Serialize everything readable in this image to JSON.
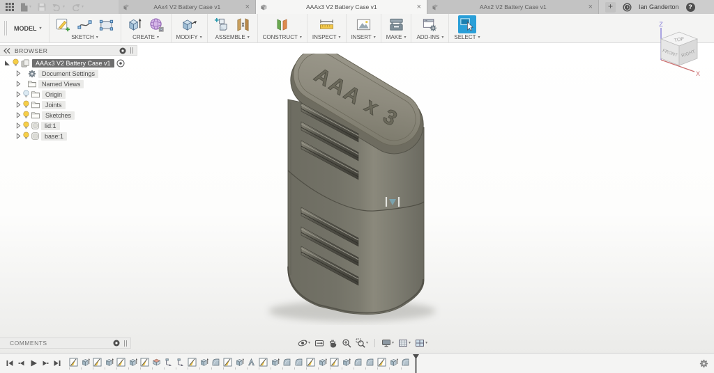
{
  "window": {
    "user_name": "Ian Ganderton",
    "new_tab_glyph": "+",
    "close_glyph": "×",
    "help_glyph": "?",
    "quick_actions": [
      "app-grid",
      "file-new",
      "save",
      "undo",
      "redo"
    ],
    "tabs": [
      {
        "label": "AAx4 V2 Battery Case v1",
        "active": false
      },
      {
        "label": "AAAx3 V2 Battery Case v1",
        "active": true
      },
      {
        "label": "AAx2 V2 Battery Case v1",
        "active": false
      }
    ]
  },
  "toolbar": {
    "workspace_label": "MODEL",
    "groups": [
      {
        "label": "SKETCH",
        "tools": [
          "create-sketch",
          "spline",
          "rectangle"
        ]
      },
      {
        "label": "CREATE",
        "tools": [
          "extrude",
          "form"
        ]
      },
      {
        "label": "MODIFY",
        "tools": [
          "press-pull"
        ]
      },
      {
        "label": "ASSEMBLE",
        "tools": [
          "new-component",
          "joint"
        ]
      },
      {
        "label": "CONSTRUCT",
        "tools": [
          "construction-plane"
        ]
      },
      {
        "label": "INSPECT",
        "tools": [
          "measure"
        ]
      },
      {
        "label": "INSERT",
        "tools": [
          "insert-image"
        ]
      },
      {
        "label": "MAKE",
        "tools": [
          "print-3d"
        ]
      },
      {
        "label": "ADD-INS",
        "tools": [
          "scripts-addins"
        ]
      },
      {
        "label": "SELECT",
        "tools": [
          "select"
        ],
        "highlighted": true
      }
    ]
  },
  "browser": {
    "title": "BROWSER",
    "root": {
      "label": "AAAx3 V2 Battery Case v1",
      "selected": true
    },
    "items": [
      {
        "label": "Document Settings",
        "icon": "gear"
      },
      {
        "label": "Named Views",
        "icon": "folder"
      },
      {
        "label": "Origin",
        "icon": "folder",
        "bulb": "off"
      },
      {
        "label": "Joints",
        "icon": "folder",
        "bulb": "on"
      },
      {
        "label": "Sketches",
        "icon": "folder",
        "bulb": "on"
      },
      {
        "label": "lid:1",
        "icon": "component",
        "bulb": "on"
      },
      {
        "label": "base:1",
        "icon": "component",
        "bulb": "on"
      }
    ]
  },
  "viewcube": {
    "top": "TOP",
    "front": "FRONT",
    "right": "RIGHT",
    "axis_z": "Z",
    "axis_x": "X"
  },
  "model": {
    "engraving": "AAA x 3",
    "body_color": "#75746a",
    "lid_color": "#908d7f",
    "ridge_color": "#4f4e45"
  },
  "comments": {
    "label": "COMMENTS"
  },
  "navbar": {
    "tools": [
      "orbit",
      "look-at",
      "pan",
      "zoom",
      "window-zoom",
      "display-settings",
      "grid-display",
      "viewports"
    ]
  },
  "timeline": {
    "controls": [
      "go-to-start",
      "step-back",
      "play",
      "step-forward",
      "go-to-end"
    ],
    "features": [
      "sketch",
      "extrude",
      "sketch",
      "extrude",
      "sketch",
      "extrude",
      "sketch",
      "shell",
      "joint-origin",
      "joint-origin",
      "sketch",
      "extrude",
      "fillet",
      "sketch",
      "extrude",
      "draft",
      "sketch",
      "extrude",
      "fillet",
      "fillet",
      "sketch",
      "extrude",
      "sketch",
      "extrude",
      "fillet",
      "fillet",
      "sketch",
      "extrude",
      "fillet"
    ]
  },
  "colors": {
    "accent_blue": "#2a9fd8",
    "bulb_yellow": "#f6ce47",
    "selection_gray": "#6e6e6e"
  }
}
